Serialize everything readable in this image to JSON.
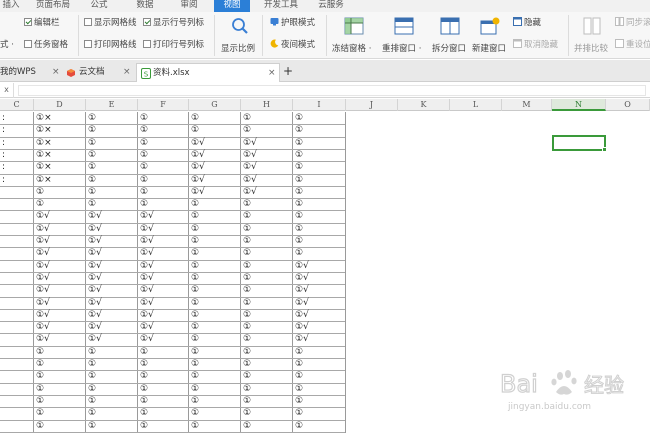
{
  "menu": {
    "tabs": [
      "插入",
      "页面布局",
      "公式",
      "数据",
      "审阅",
      "视图",
      "开发工具",
      "云服务"
    ],
    "active_tab": "视图"
  },
  "ribbon": {
    "left_fragment": "式 ·",
    "checkboxes": {
      "edit_bar": {
        "label": "编辑栏",
        "checked": true
      },
      "task_pane": {
        "label": "任务窗格",
        "checked": false
      },
      "show_gridlines": {
        "label": "显示网格线",
        "checked": false
      },
      "print_gridlines": {
        "label": "打印网格线",
        "checked": false
      },
      "show_row_col_headers": {
        "label": "显示行号列标",
        "checked": true
      },
      "print_row_col_headers": {
        "label": "打印行号列标",
        "checked": false
      }
    },
    "zoom_label": "显示比例",
    "eye_protection": "护眼模式",
    "night_mode": "夜间模式",
    "freeze_panes": "冻结窗格 ·",
    "rearrange_windows": "重排窗口 ·",
    "split_window": "拆分窗口",
    "new_window": "新建窗口",
    "hide": "隐藏",
    "unhide": "取消隐藏",
    "side_by_side": "并排比较",
    "sync_scroll": "同步滚",
    "reset_position": "重设位"
  },
  "tabs": [
    {
      "label": "我的WPS",
      "icon": "wps-logo-icon",
      "active": false
    },
    {
      "label": "云文档",
      "icon": "cloud-doc-icon",
      "active": false
    },
    {
      "label": "资料.xlsx",
      "icon": "spreadsheet-file-icon",
      "active": true
    }
  ],
  "new_tab_symbol": "+",
  "close_symbol": "×",
  "formula_bar": {
    "name_box_fragment": "x"
  },
  "columns": [
    "C",
    "D",
    "E",
    "F",
    "G",
    "H",
    "I",
    "J",
    "K",
    "L",
    "M",
    "N",
    "O"
  ],
  "selected_column": "N",
  "rows": [
    [
      ":",
      "①×",
      "①",
      "①",
      "①",
      "①",
      "①"
    ],
    [
      ":",
      "①×",
      "①",
      "①",
      "①",
      "①",
      "①"
    ],
    [
      ":",
      "①×",
      "①",
      "①",
      "①√",
      "①√",
      "①"
    ],
    [
      ":",
      "①×",
      "①",
      "①",
      "①√",
      "①√",
      "①"
    ],
    [
      ":",
      "①×",
      "①",
      "①",
      "①√",
      "①√",
      "①"
    ],
    [
      ":",
      "①×",
      "①",
      "①",
      "①√",
      "①√",
      "①"
    ],
    [
      "",
      "①",
      "①",
      "①",
      "①√",
      "①√",
      "①"
    ],
    [
      "",
      "①",
      "①",
      "①",
      "①",
      "①",
      "①"
    ],
    [
      "",
      "①√",
      "①√",
      "①√",
      "①",
      "①",
      "①"
    ],
    [
      "",
      "①√",
      "①√",
      "①√",
      "①",
      "①",
      "①"
    ],
    [
      "",
      "①√",
      "①√",
      "①√",
      "①",
      "①",
      "①"
    ],
    [
      "",
      "①√",
      "①√",
      "①√",
      "①",
      "①",
      "①"
    ],
    [
      "",
      "①√",
      "①√",
      "①√",
      "①",
      "①",
      "①√"
    ],
    [
      "",
      "①√",
      "①√",
      "①√",
      "①",
      "①",
      "①√"
    ],
    [
      "",
      "①√",
      "①√",
      "①√",
      "①",
      "①",
      "①√"
    ],
    [
      "",
      "①√",
      "①√",
      "①√",
      "①",
      "①",
      "①√"
    ],
    [
      "",
      "①√",
      "①√",
      "①√",
      "①",
      "①",
      "①√"
    ],
    [
      "",
      "①√",
      "①√",
      "①√",
      "①",
      "①",
      "①√"
    ],
    [
      "",
      "①√",
      "①√",
      "①√",
      "①",
      "①",
      "①√"
    ],
    [
      "",
      "①",
      "①",
      "①",
      "①",
      "①",
      "①"
    ],
    [
      "",
      "①",
      "①",
      "①",
      "①",
      "①",
      "①"
    ],
    [
      "",
      "①",
      "①",
      "①",
      "①",
      "①",
      "①"
    ],
    [
      "",
      "①",
      "①",
      "①",
      "①",
      "①",
      "①"
    ],
    [
      "",
      "①",
      "①",
      "①",
      "①",
      "①",
      "①"
    ],
    [
      "",
      "①",
      "①",
      "①",
      "①",
      "①",
      "①"
    ],
    [
      "",
      "①",
      "①",
      "①",
      "①",
      "①",
      "①"
    ]
  ],
  "watermark": {
    "brand_text": "Bai 经验",
    "url": "jingyan.baidu.com"
  },
  "colors": {
    "accent_blue": "#2b7fd7",
    "selection_green": "#3a9a3a"
  }
}
